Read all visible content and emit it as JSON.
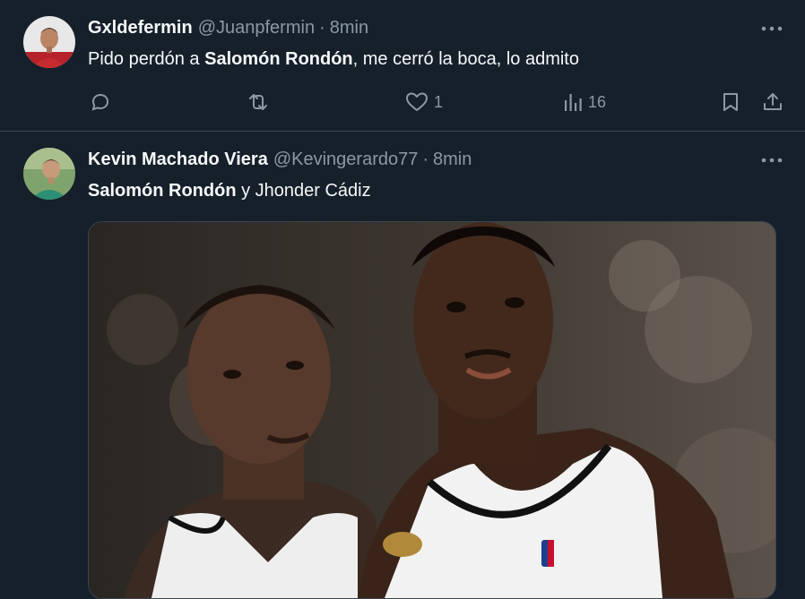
{
  "tweets": [
    {
      "author_name": "Gxldefermin",
      "handle": "@Juanpfermin",
      "separator": "·",
      "time": "8min",
      "text_pre": "Pido perdón a ",
      "text_bold": "Salomón Rondón",
      "text_post": ", me cerró la boca, lo admito",
      "actions": {
        "reply_icon": "reply-icon",
        "retweet_icon": "retweet-icon",
        "like_icon": "heart-icon",
        "like_count": "1",
        "views_icon": "views-icon",
        "views_count": "16",
        "bookmark_icon": "bookmark-icon",
        "share_icon": "share-icon"
      }
    },
    {
      "author_name": "Kevin Machado Viera",
      "handle": "@Kevingerardo77",
      "separator": "·",
      "time": "8min",
      "text_bold": "Salomón Rondón",
      "text_post": " y Jhonder Cádiz",
      "media_icon": "basketball-players-photo"
    }
  ],
  "colors": {
    "background": "#15202b",
    "text": "#f7f9f9",
    "secondary": "#8b98a5",
    "border": "#38444d"
  }
}
